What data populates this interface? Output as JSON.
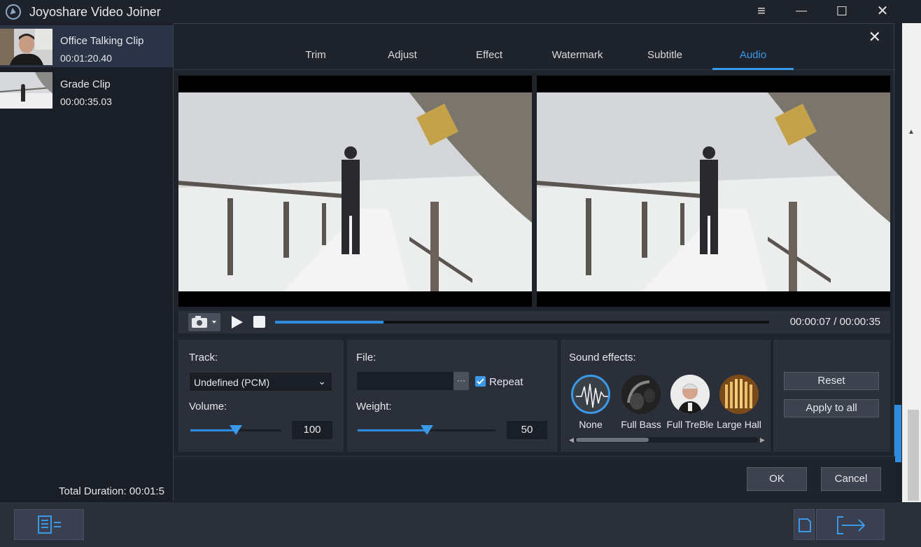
{
  "app": {
    "title": "Joyoshare Video Joiner"
  },
  "window": {
    "menu_icon": "≡",
    "min_icon": "—",
    "max_icon": "☐",
    "close_icon": "✕"
  },
  "clips": [
    {
      "name": "Office Talking Clip",
      "duration": "00:01:20.40",
      "selected": true
    },
    {
      "name": "Grade Clip",
      "duration": "00:00:35.03",
      "selected": false
    }
  ],
  "total_duration": "Total Duration: 00:01:5",
  "dialog": {
    "close_icon": "✕",
    "tabs": [
      {
        "label": "Trim"
      },
      {
        "label": "Adjust"
      },
      {
        "label": "Effect"
      },
      {
        "label": "Watermark"
      },
      {
        "label": "Subtitle"
      },
      {
        "label": "Audio",
        "active": true
      }
    ],
    "playback": {
      "current": "00:00:07",
      "total": "00:00:35",
      "timecode": "00:00:07 / 00:00:35",
      "progress": 0.22
    },
    "track": {
      "label": "Track:",
      "value": "Undefined (PCM)"
    },
    "volume": {
      "label": "Volume:",
      "value": "100",
      "level": 0.5
    },
    "file": {
      "label": "File:",
      "value": "",
      "browse": "···",
      "repeat_label": "Repeat",
      "repeat_checked": true
    },
    "weight": {
      "label": "Weight:",
      "value": "50",
      "level": 0.5
    },
    "sound_effects": {
      "label": "Sound effects:",
      "items": [
        {
          "label": "None",
          "selected": true
        },
        {
          "label": "Full Bass"
        },
        {
          "label": "Full TreBle"
        },
        {
          "label": "Large Hall"
        }
      ]
    },
    "reset_label": "Reset",
    "apply_all_label": "Apply to all",
    "ok_label": "OK",
    "cancel_label": "Cancel"
  },
  "colors": {
    "accent": "#3b9ae8",
    "panel": "#2a2f3a",
    "background": "#1f232b"
  }
}
